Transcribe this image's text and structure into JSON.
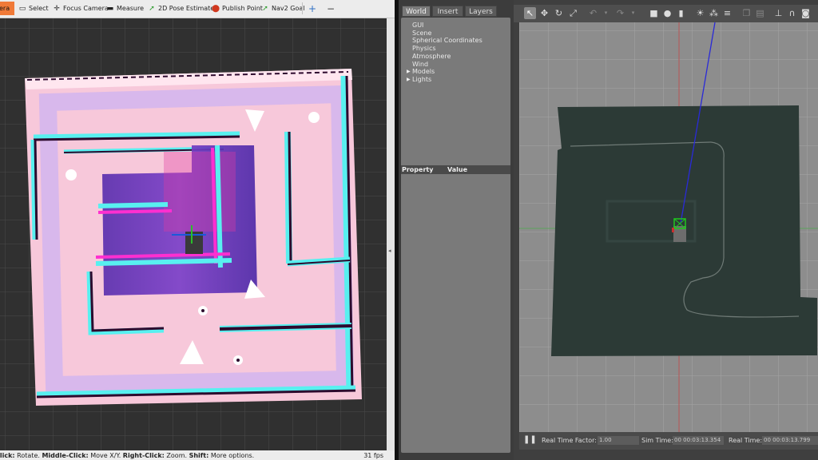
{
  "rviz": {
    "toolbar": {
      "interact": "era",
      "select": "Select",
      "focus_camera": "Focus Camera",
      "measure": "Measure",
      "pose_estimate": "2D Pose Estimate",
      "publish_point": "Publish Point",
      "nav2_goal": "Nav2 Goal",
      "add": "+",
      "remove": "−"
    },
    "status": {
      "hint_prefix": "Click:",
      "hint_rest": " Rotate. ",
      "middle": "Middle-Click:",
      "middle_rest": " Move X/Y. ",
      "right": "Right-Click:",
      "right_rest": " Zoom. ",
      "shift": "Shift:",
      "shift_rest": " More options.",
      "fps": "31 fps"
    },
    "splitter_glyph": "◂",
    "colors": {
      "active_tool": "#f07a38",
      "costmap_edge": "#58f0f0",
      "obstacle": "#2d0a2e"
    }
  },
  "gazebo": {
    "tabs": [
      "World",
      "Insert",
      "Layers"
    ],
    "tree": [
      {
        "label": "GUI",
        "expandable": false
      },
      {
        "label": "Scene",
        "expandable": false
      },
      {
        "label": "Spherical Coordinates",
        "expandable": false
      },
      {
        "label": "Physics",
        "expandable": false
      },
      {
        "label": "Atmosphere",
        "expandable": false
      },
      {
        "label": "Wind",
        "expandable": false
      },
      {
        "label": "Models",
        "expandable": true
      },
      {
        "label": "Lights",
        "expandable": true
      }
    ],
    "properties": {
      "col1": "Property",
      "col2": "Value"
    },
    "bottom": {
      "pause_icon": "pause-icon",
      "rtf_label": "Real Time Factor:",
      "rtf_value": "1.00",
      "sim_label": "Sim Time:",
      "sim_value": "00 00:03:13.354",
      "real_label": "Real Time:",
      "real_value": "00 00:03:13.799"
    }
  }
}
